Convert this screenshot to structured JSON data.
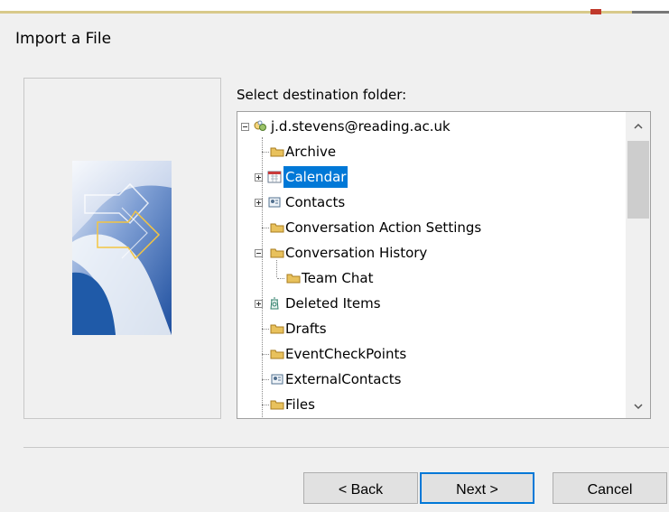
{
  "dialog": {
    "title": "Import a File",
    "destination_label": "Select destination folder:",
    "buttons": {
      "back": "< Back",
      "next": "Next >",
      "cancel": "Cancel"
    }
  },
  "tree": {
    "root": "j.d.stevens@reading.ac.uk",
    "items": [
      {
        "label": "Archive",
        "icon": "folder-icon"
      },
      {
        "label": "Calendar",
        "icon": "calendar-icon",
        "selected": true
      },
      {
        "label": "Contacts",
        "icon": "contacts-icon"
      },
      {
        "label": "Conversation Action Settings",
        "icon": "folder-icon"
      },
      {
        "label": "Conversation History",
        "icon": "folder-icon"
      },
      {
        "label": "Team Chat",
        "icon": "folder-icon"
      },
      {
        "label": "Deleted Items",
        "icon": "recycle-icon"
      },
      {
        "label": "Drafts",
        "icon": "folder-icon"
      },
      {
        "label": "EventCheckPoints",
        "icon": "folder-icon"
      },
      {
        "label": "ExternalContacts",
        "icon": "contacts-icon"
      },
      {
        "label": "Files",
        "icon": "folder-icon"
      }
    ]
  },
  "icons": {
    "root": "mailbox-icon",
    "expander_collapsed": "plus-square-icon",
    "expander_expanded": "minus-square-icon",
    "scroll_up": "chevron-up-icon",
    "scroll_down": "chevron-down-icon"
  },
  "colors": {
    "selection": "#0078d7",
    "dialog_background": "#f0f0f0",
    "folder_yellow": "#e8c15c",
    "accent_blue": "#2d5aa8"
  }
}
